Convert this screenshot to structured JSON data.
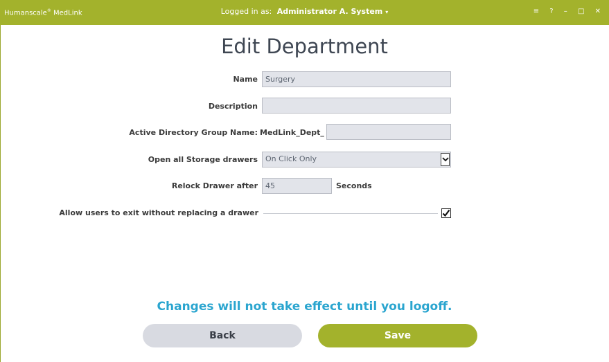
{
  "titlebar": {
    "app_name": "Humanscale",
    "app_mark": "®",
    "app_suffix": " MedLink",
    "logged_in_label": "Logged in as:",
    "user_name": "Administrator A. System",
    "user_caret": "▾",
    "icons": [
      "menu-icon",
      "help-icon",
      "minimize-icon",
      "maximize-icon",
      "close-icon"
    ],
    "brand_color": "#a3b22c"
  },
  "page": {
    "title": "Edit Department"
  },
  "form": {
    "name_label": "Name",
    "name_value": "Surgery",
    "description_label": "Description",
    "description_value": "",
    "ad_group_label": "Active Directory Group Name:",
    "ad_group_prefix": "MedLink_Dept_",
    "ad_group_value": "",
    "open_drawers_label": "Open all Storage drawers",
    "open_drawers_value": "On Click Only",
    "relock_label": "Relock Drawer after",
    "relock_value": "45",
    "relock_unit": "Seconds",
    "allow_exit_label": "Allow users to exit without replacing a drawer",
    "allow_exit_checked": true
  },
  "notice": "Changes will not take effect until you logoff.",
  "buttons": {
    "back": "Back",
    "save": "Save"
  }
}
